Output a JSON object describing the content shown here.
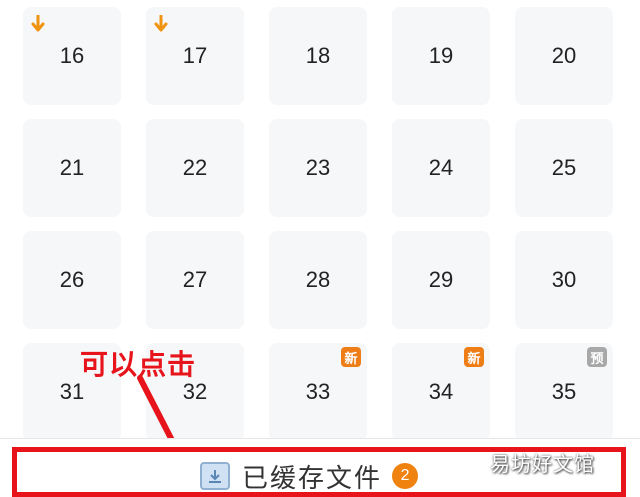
{
  "episodes": [
    {
      "num": "16",
      "downloaded": true,
      "badge": ""
    },
    {
      "num": "17",
      "downloaded": true,
      "badge": ""
    },
    {
      "num": "18",
      "downloaded": false,
      "badge": ""
    },
    {
      "num": "19",
      "downloaded": false,
      "badge": ""
    },
    {
      "num": "20",
      "downloaded": false,
      "badge": ""
    },
    {
      "num": "21",
      "downloaded": false,
      "badge": ""
    },
    {
      "num": "22",
      "downloaded": false,
      "badge": ""
    },
    {
      "num": "23",
      "downloaded": false,
      "badge": ""
    },
    {
      "num": "24",
      "downloaded": false,
      "badge": ""
    },
    {
      "num": "25",
      "downloaded": false,
      "badge": ""
    },
    {
      "num": "26",
      "downloaded": false,
      "badge": ""
    },
    {
      "num": "27",
      "downloaded": false,
      "badge": ""
    },
    {
      "num": "28",
      "downloaded": false,
      "badge": ""
    },
    {
      "num": "29",
      "downloaded": false,
      "badge": ""
    },
    {
      "num": "30",
      "downloaded": false,
      "badge": ""
    },
    {
      "num": "31",
      "downloaded": false,
      "badge": ""
    },
    {
      "num": "32",
      "downloaded": false,
      "badge": ""
    },
    {
      "num": "33",
      "downloaded": false,
      "badge": "新"
    },
    {
      "num": "34",
      "downloaded": false,
      "badge": "新"
    },
    {
      "num": "35",
      "downloaded": false,
      "badge": "预"
    }
  ],
  "badge_colors": {
    "新": "#ee7d16",
    "预": "#a8a8a8"
  },
  "annotation": {
    "text": "可以点击",
    "color": "#e8141b"
  },
  "bottom_bar": {
    "label": "已缓存文件",
    "count": "2"
  },
  "watermark": "易坊好文馆"
}
